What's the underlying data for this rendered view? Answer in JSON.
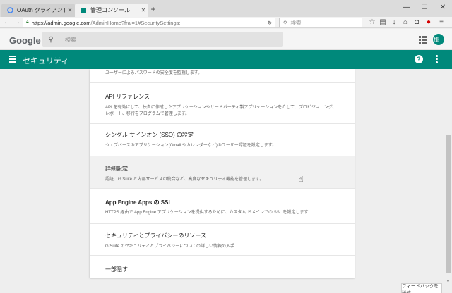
{
  "browser": {
    "tabs": [
      {
        "title": "OAuth クライアント - Passwo...",
        "active": false
      },
      {
        "title": "管理コンソール",
        "active": true
      }
    ],
    "url_domain": "https://admin.google.com",
    "url_path": "/AdminHome?fral=1#SecuritySettings:",
    "search_placeholder": "検索",
    "icons": [
      "back-icon",
      "forward-icon",
      "lock-icon",
      "reload-icon",
      "star-icon",
      "reading-list-icon",
      "download-icon",
      "home-icon",
      "pocket-icon",
      "opera-icon",
      "menu-icon"
    ]
  },
  "google_bar": {
    "logo": "Google",
    "search_placeholder": "検索",
    "avatar_text": "種一"
  },
  "admin_header": {
    "title": "セキュリティ"
  },
  "settings": [
    {
      "title": "",
      "description": "ユーザーによるパスワードの安全度を監視します。"
    },
    {
      "title": "API リファレンス",
      "description": "API を有効にして、独自に作成したアプリケーションやサードパーティ製アプリケーションを介して、プロビジョニング、レポート、移行をプログラムで管理します。"
    },
    {
      "title": "シングル サインオン (SSO) の設定",
      "description": "ウェブベースのアプリケーション(Gmail やカレンダーなど)のユーザー認証を設定します。"
    },
    {
      "title": "詳細設定",
      "description": "認証、G Suite と内部サービスの統合など、高度なセキュリティ機能を管理します。"
    },
    {
      "title": "App Engine Apps の SSL",
      "description": "HTTPS 経由で App Engine アプリケーションを提供するために、カスタム ドメインでの SSL を設定します"
    },
    {
      "title": "セキュリティとプライバシーのリソース",
      "description": "G Suite のセキュリティとプライバシーについての詳しい情報の入手"
    },
    {
      "title": "一部隠す",
      "description": ""
    }
  ],
  "feedback": "フィードバックを送信",
  "colors": {
    "accent": "#00897b"
  }
}
